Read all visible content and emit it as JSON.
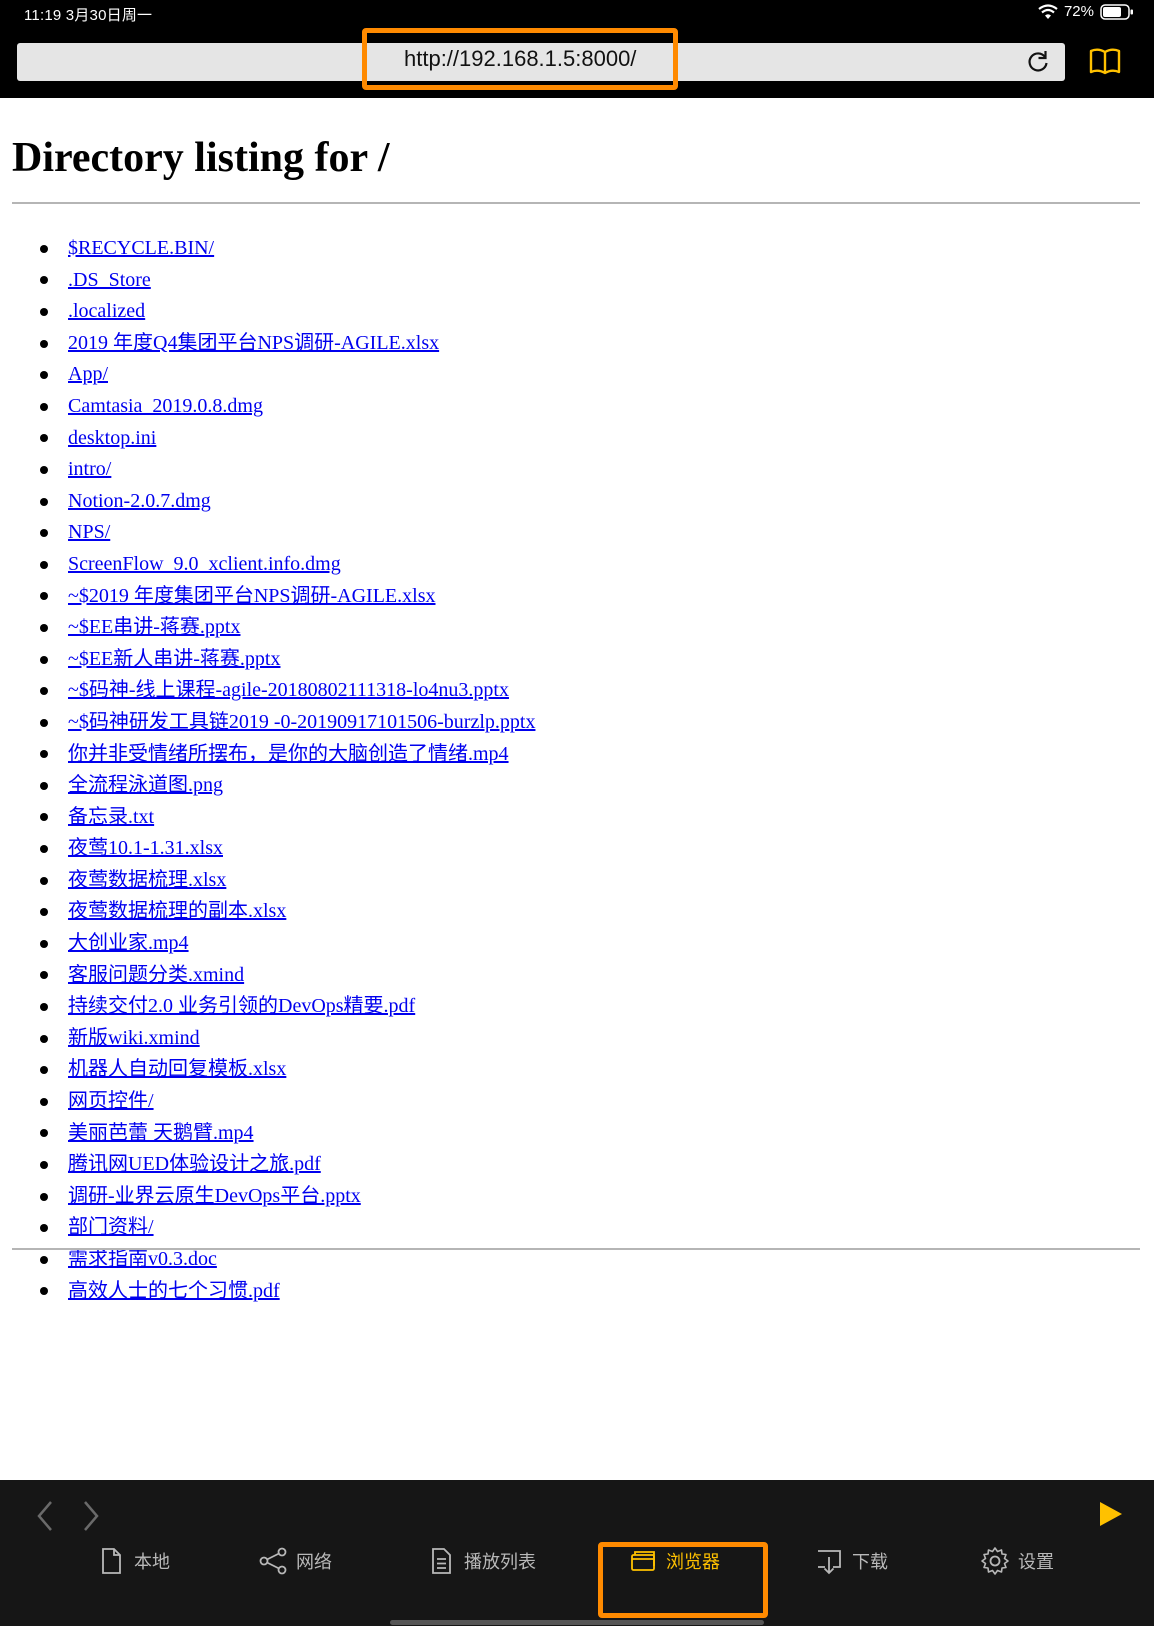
{
  "status_bar": {
    "time": "11:19  3月30日周一",
    "battery": "72%"
  },
  "browser": {
    "url": "http://192.168.1.5:8000/"
  },
  "page": {
    "title": "Directory listing for /",
    "entries": [
      "$RECYCLE.BIN/",
      ".DS_Store",
      ".localized",
      "2019 年度Q4集团平台NPS调研-AGILE.xlsx",
      "App/",
      "Camtasia_2019.0.8.dmg",
      "desktop.ini",
      "intro/",
      "Notion-2.0.7.dmg",
      "NPS/",
      "ScreenFlow_9.0_xclient.info.dmg",
      "~$2019 年度集团平台NPS调研-AGILE.xlsx",
      "~$EE串讲-蒋赛.pptx",
      "~$EE新人串讲-蒋赛.pptx",
      "~$码神-线上课程-agile-20180802111318-lo4nu3.pptx",
      "~$码神研发工具链2019 -0-20190917101506-burzlp.pptx",
      "你并非受情绪所摆布，是你的大脑创造了情绪.mp4",
      "全流程泳道图.png",
      "备忘录.txt",
      "夜莺10.1-1.31.xlsx",
      "夜莺数据梳理.xlsx",
      "夜莺数据梳理的副本.xlsx",
      "大创业家.mp4",
      "客服问题分类.xmind",
      "持续交付2.0 业务引领的DevOps精要.pdf",
      "新版wiki.xmind",
      "机器人自动回复模板.xlsx",
      "网页控件/",
      "美丽芭蕾 天鹅臂.mp4",
      "腾讯网UED体验设计之旅.pdf",
      "调研-业界云原生DevOps平台.pptx",
      "部门资料/",
      "需求指南v0.3.doc",
      "高效人士的七个习惯.pdf"
    ]
  },
  "tab_bar": {
    "tabs": [
      {
        "key": "local",
        "label": "本地",
        "icon": "document-icon",
        "active": false
      },
      {
        "key": "network",
        "label": "网络",
        "icon": "share-icon",
        "active": false
      },
      {
        "key": "playlist",
        "label": "播放列表",
        "icon": "list-icon",
        "active": false
      },
      {
        "key": "browser",
        "label": "浏览器",
        "icon": "browser-icon",
        "active": true
      },
      {
        "key": "download",
        "label": "下载",
        "icon": "download-icon",
        "active": false
      },
      {
        "key": "settings",
        "label": "设置",
        "icon": "gear-icon",
        "active": false
      }
    ]
  },
  "colors": {
    "accent": "#ffc100",
    "highlight_box": "#ff8a00",
    "link": "#0000ee"
  }
}
